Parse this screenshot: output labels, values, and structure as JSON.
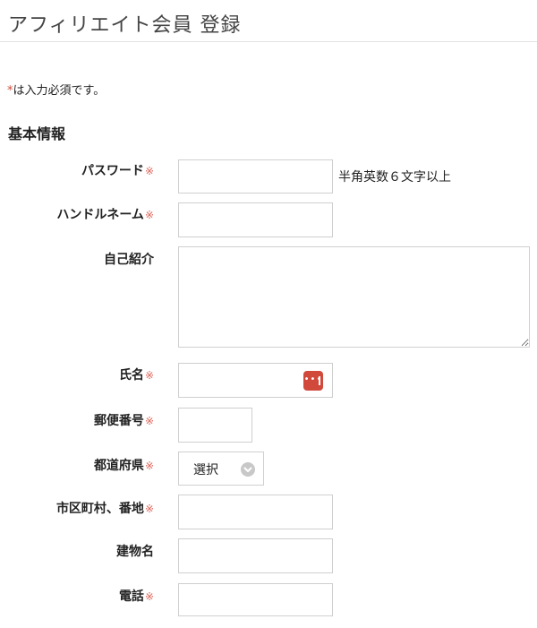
{
  "page": {
    "title": "アフィリエイト会員 登録",
    "required_mark": "*",
    "required_note": "は入力必須です。",
    "section_title": "基本情報"
  },
  "form": {
    "field_required_mark": "※",
    "password": {
      "label": "パスワード",
      "value": "",
      "hint": "半角英数６文字以上"
    },
    "handle_name": {
      "label": "ハンドルネーム",
      "value": ""
    },
    "self_intro": {
      "label": "自己紹介",
      "value": ""
    },
    "full_name": {
      "label": "氏名",
      "value": ""
    },
    "postal_code": {
      "label": "郵便番号",
      "value": ""
    },
    "prefecture": {
      "label": "都道府県",
      "selected": "選択"
    },
    "city_address": {
      "label": "市区町村、番地",
      "value": ""
    },
    "building": {
      "label": "建物名",
      "value": ""
    },
    "phone": {
      "label": "電話",
      "value": ""
    }
  },
  "colors": {
    "required": "#d0493a",
    "border": "#cfcfcf",
    "autofill_icon": "#d0493a"
  },
  "icons": {
    "autofill": "contacts-autofill-icon",
    "select_arrow": "chevron-down-icon"
  }
}
